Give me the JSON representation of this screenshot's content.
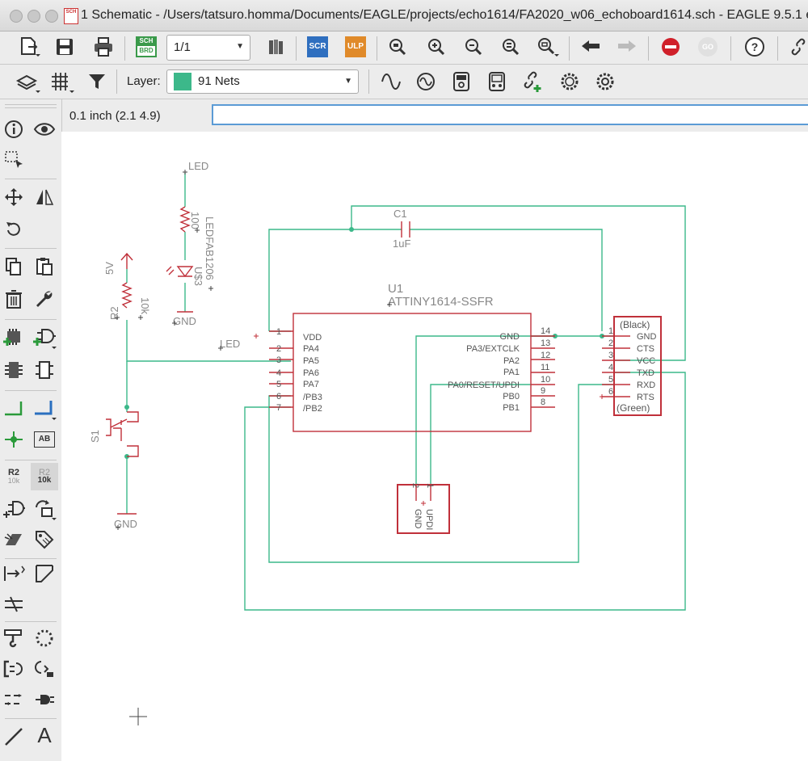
{
  "window": {
    "title": "1 Schematic - /Users/tatsuro.homma/Documents/EAGLE/projects/echo1614/FA2020_w06_echoboard1614.sch - EAGLE 9.5.1 e"
  },
  "toolbar1": {
    "sheet_value": "1/1",
    "sch_brd_top": "SCH",
    "sch_brd_bottom": "BRD",
    "scr_label": "SCR",
    "ulp_label": "ULP",
    "go_label": "GO"
  },
  "toolbar2": {
    "layer_label": "Layer:",
    "layer_value": "91 Nets",
    "layer_color": "#3cb88a"
  },
  "command": {
    "grid_coord": "0.1 inch (2.1 4.9)",
    "input_value": ""
  },
  "tools": {
    "value_r2": "R2",
    "value_10k": "10k",
    "text_tool": "A",
    "ab_label": "AB"
  },
  "schematic": {
    "colors": {
      "net": "#3cb88a",
      "part": "#c0303a",
      "text": "#888888",
      "origin": "#444444"
    },
    "led_r1": {
      "net": "LED",
      "ref": "R1",
      "value": "100",
      "led_ref": "U$3",
      "led_value": "LEDFAB1206",
      "gnd": "GND"
    },
    "r2": {
      "supply": "5V",
      "ref": "R2",
      "value": "10k"
    },
    "c1": {
      "ref": "C1",
      "value": "1uF"
    },
    "u1": {
      "ref": "U1",
      "value": "ATTINY1614-SSFR",
      "left_pins": [
        {
          "num": "1",
          "name": "VDD"
        },
        {
          "num": "2",
          "name": "PA4"
        },
        {
          "num": "3",
          "name": "PA5"
        },
        {
          "num": "4",
          "name": "PA6"
        },
        {
          "num": "5",
          "name": "PA7"
        },
        {
          "num": "6",
          "name": "/PB3"
        },
        {
          "num": "7",
          "name": "/PB2"
        }
      ],
      "right_pins": [
        {
          "num": "14",
          "name": "GND"
        },
        {
          "num": "13",
          "name": "PA3/EXTCLK"
        },
        {
          "num": "12",
          "name": "PA2"
        },
        {
          "num": "11",
          "name": "PA1"
        },
        {
          "num": "10",
          "name": "PA0/RESET/UPDI"
        },
        {
          "num": "9",
          "name": "PB0"
        },
        {
          "num": "8",
          "name": "PB1"
        }
      ]
    },
    "led_net_label": "LED",
    "ftdi": {
      "top": "(Black)",
      "bottom": "(Green)",
      "pins": [
        {
          "num": "1",
          "name": "GND"
        },
        {
          "num": "2",
          "name": "CTS"
        },
        {
          "num": "3",
          "name": "VCC"
        },
        {
          "num": "4",
          "name": "TXD"
        },
        {
          "num": "5",
          "name": "RXD"
        },
        {
          "num": "6",
          "name": "RTS"
        }
      ]
    },
    "s1": {
      "ref": "S1",
      "gnd": "GND"
    },
    "updi": {
      "pin_a": "GND",
      "pin_b": "UPDI",
      "num_a": "2",
      "num_b": "1"
    }
  }
}
